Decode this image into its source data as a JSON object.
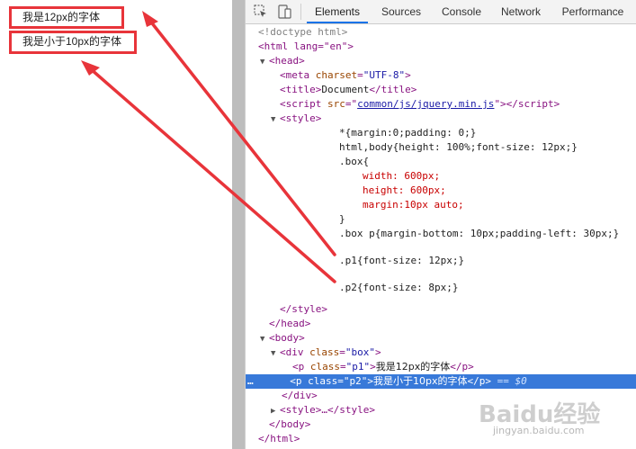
{
  "page": {
    "p1_text": "我是12px的字体",
    "p2_text": "我是小于10px的字体"
  },
  "toolbar": {
    "tabs": [
      "Elements",
      "Sources",
      "Console",
      "Network",
      "Performance"
    ],
    "active_tab": "Elements",
    "accent": "#1a73e8"
  },
  "tree": {
    "doctype": "<!doctype html>",
    "html_open": "<html lang=\"en\">",
    "head_open": "<head>",
    "meta_line": "<meta charset=\"UTF-8\">",
    "title_line": "<title>Document</title>",
    "script_src": "common/js/jquery.min.js",
    "style_open": "<style>",
    "css_1": "*{margin:0;padding: 0;}",
    "css_2": "html,body{height: 100%;font-size: 12px;}",
    "css_3": ".box{",
    "css_4": "width: 600px;",
    "css_5": "height: 600px;",
    "css_6": "margin:10px auto;",
    "css_7": "}",
    "css_8": ".box p{margin-bottom: 10px;padding-left: 30px;}",
    "css_9": ".p1{font-size: 12px;}",
    "css_10": ".p2{font-size: 8px;}",
    "style_close": "</style>",
    "head_close": "</head>",
    "body_open": "<body>",
    "div_open": "<div class=\"box\">",
    "p1_line": "我是12px的字体",
    "p2_line": "我是小于10px的字体",
    "selected_suffix": "== $0",
    "div_close": "</div>",
    "style_collapsed": "<style>…</style>",
    "body_close": "</body>",
    "html_close": "</html>"
  },
  "annotation_color": "#e8343a",
  "watermark": {
    "logo": "Baidu经验",
    "url": "jingyan.baidu.com"
  }
}
